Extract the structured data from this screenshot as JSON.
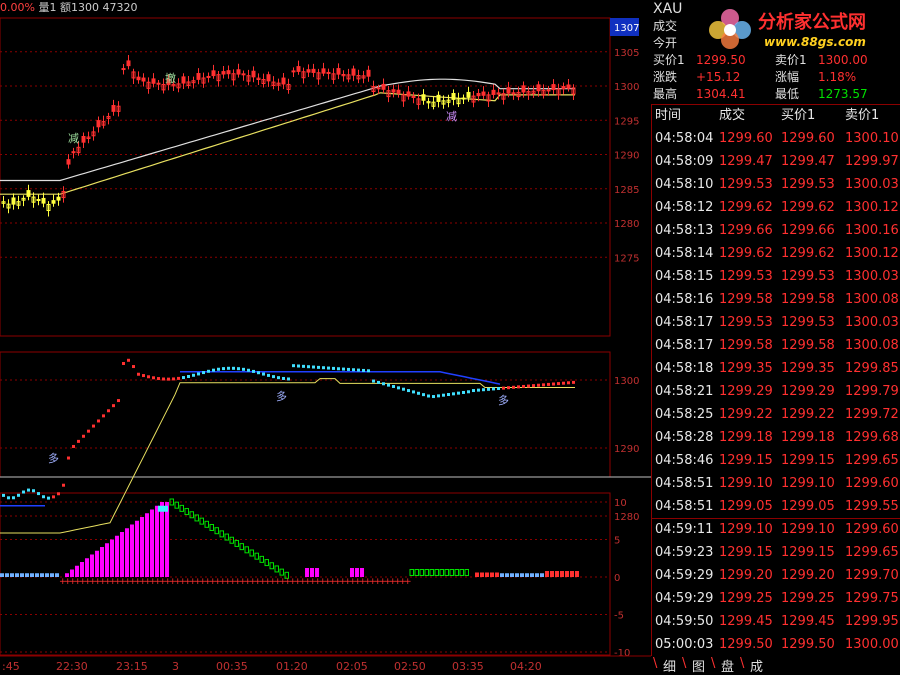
{
  "topbar": {
    "pct": "0.00%",
    "vol_label": "量1",
    "amt_label": "额1300",
    "val": "47320"
  },
  "price_axis": {
    "ticks": [
      "1307",
      "1305",
      "1300",
      "1295",
      "1290",
      "1285",
      "1280",
      "1275"
    ]
  },
  "mid_axis": {
    "ticks": [
      "1300",
      "1290",
      "1280"
    ]
  },
  "osc_axis": {
    "ticks": [
      "10",
      "5",
      "0",
      "-5",
      "-10"
    ]
  },
  "time_axis": {
    "ticks": [
      ":45",
      "22:30",
      "23:15",
      "3",
      "00:35",
      "01:20",
      "02:05",
      "02:50",
      "03:35",
      "04:20"
    ]
  },
  "annotations": {
    "jian1": "减",
    "che": "撤",
    "jian2": "减",
    "duo1": "多",
    "duo2": "多",
    "duo3": "多"
  },
  "logo": {
    "site": "分析家公式网",
    "url": "www.88gs.com"
  },
  "quote": {
    "symbol": "XAU",
    "rows": [
      {
        "l1": "成交",
        "v1": "",
        "l2": "",
        "v2": ""
      },
      {
        "l1": "今开",
        "v1": "",
        "l2": "",
        "v2": ""
      },
      {
        "l1": "买价1",
        "v1": "1299.50",
        "l2": "卖价1",
        "v2": "1300.00"
      },
      {
        "l1": "涨跌",
        "v1": "+15.12",
        "l2": "涨幅",
        "v2": "1.18%"
      },
      {
        "l1": "最高",
        "v1": "1304.41",
        "l2": "最低",
        "v2": "1273.57"
      }
    ]
  },
  "ticks_table": {
    "headers": [
      "时间",
      "成交",
      "买价1",
      "卖价1"
    ],
    "rows": [
      [
        "04:58:04",
        "1299.60",
        "1299.60",
        "1300.10"
      ],
      [
        "04:58:09",
        "1299.47",
        "1299.47",
        "1299.97"
      ],
      [
        "04:58:10",
        "1299.53",
        "1299.53",
        "1300.03"
      ],
      [
        "04:58:12",
        "1299.62",
        "1299.62",
        "1300.12"
      ],
      [
        "04:58:13",
        "1299.66",
        "1299.66",
        "1300.16"
      ],
      [
        "04:58:14",
        "1299.62",
        "1299.62",
        "1300.12"
      ],
      [
        "04:58:15",
        "1299.53",
        "1299.53",
        "1300.03"
      ],
      [
        "04:58:16",
        "1299.58",
        "1299.58",
        "1300.08"
      ],
      [
        "04:58:17",
        "1299.53",
        "1299.53",
        "1300.03"
      ],
      [
        "04:58:17",
        "1299.58",
        "1299.58",
        "1300.08"
      ],
      [
        "04:58:18",
        "1299.35",
        "1299.35",
        "1299.85"
      ],
      [
        "04:58:21",
        "1299.29",
        "1299.29",
        "1299.79"
      ],
      [
        "04:58:25",
        "1299.22",
        "1299.22",
        "1299.72"
      ],
      [
        "04:58:28",
        "1299.18",
        "1299.18",
        "1299.68"
      ],
      [
        "04:58:46",
        "1299.15",
        "1299.15",
        "1299.65"
      ],
      [
        "04:58:51",
        "1299.10",
        "1299.10",
        "1299.60"
      ],
      [
        "04:58:51",
        "1299.05",
        "1299.05",
        "1299.55"
      ],
      [
        "04:59:11",
        "1299.10",
        "1299.10",
        "1299.60"
      ],
      [
        "04:59:23",
        "1299.15",
        "1299.15",
        "1299.65"
      ],
      [
        "04:59:29",
        "1299.20",
        "1299.20",
        "1299.70"
      ],
      [
        "04:59:29",
        "1299.25",
        "1299.25",
        "1299.75"
      ],
      [
        "04:59:50",
        "1299.45",
        "1299.45",
        "1299.95"
      ],
      [
        "05:00:03",
        "1299.50",
        "1299.50",
        "1300.00"
      ]
    ]
  },
  "tabs": [
    "细",
    "图",
    "盘",
    "成"
  ],
  "colors": {
    "up": "#ff3030",
    "down": "#00e000",
    "grid": "#8b0000",
    "magenta": "#ff00ff",
    "cyan": "#40e0ff",
    "yellow": "#e8e060",
    "white_ma": "#e0e0e0"
  }
}
